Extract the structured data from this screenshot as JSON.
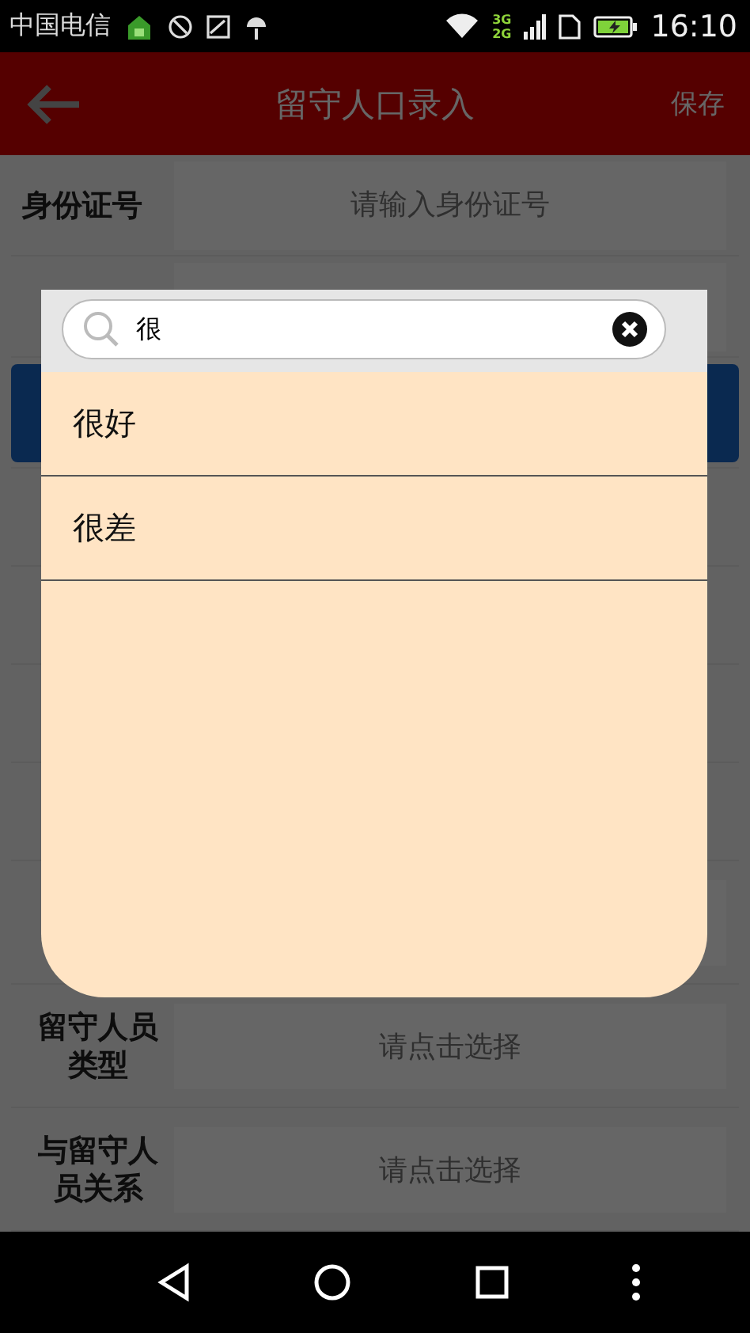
{
  "status_bar": {
    "carrier": "中国电信",
    "network_top": "3G",
    "network_bottom": "2G",
    "time": "16:10"
  },
  "app_bar": {
    "title": "留守人口录入",
    "action": "保存"
  },
  "form": {
    "rows": [
      {
        "kind": "input",
        "label": "身份证号",
        "placeholder": "请输入身份证号"
      },
      {
        "kind": "input"
      },
      {
        "kind": "button"
      },
      {
        "kind": "blank"
      },
      {
        "kind": "blank"
      },
      {
        "kind": "blank"
      },
      {
        "kind": "blank"
      },
      {
        "kind": "select"
      },
      {
        "kind": "select",
        "label": "留守人员类型",
        "placeholder": "请点击选择"
      },
      {
        "kind": "select",
        "label": "与留守人员关系",
        "placeholder": "请点击选择"
      }
    ]
  },
  "dialog": {
    "search": {
      "value": "很"
    },
    "items": [
      {
        "label": "很好"
      },
      {
        "label": "很差"
      }
    ]
  }
}
